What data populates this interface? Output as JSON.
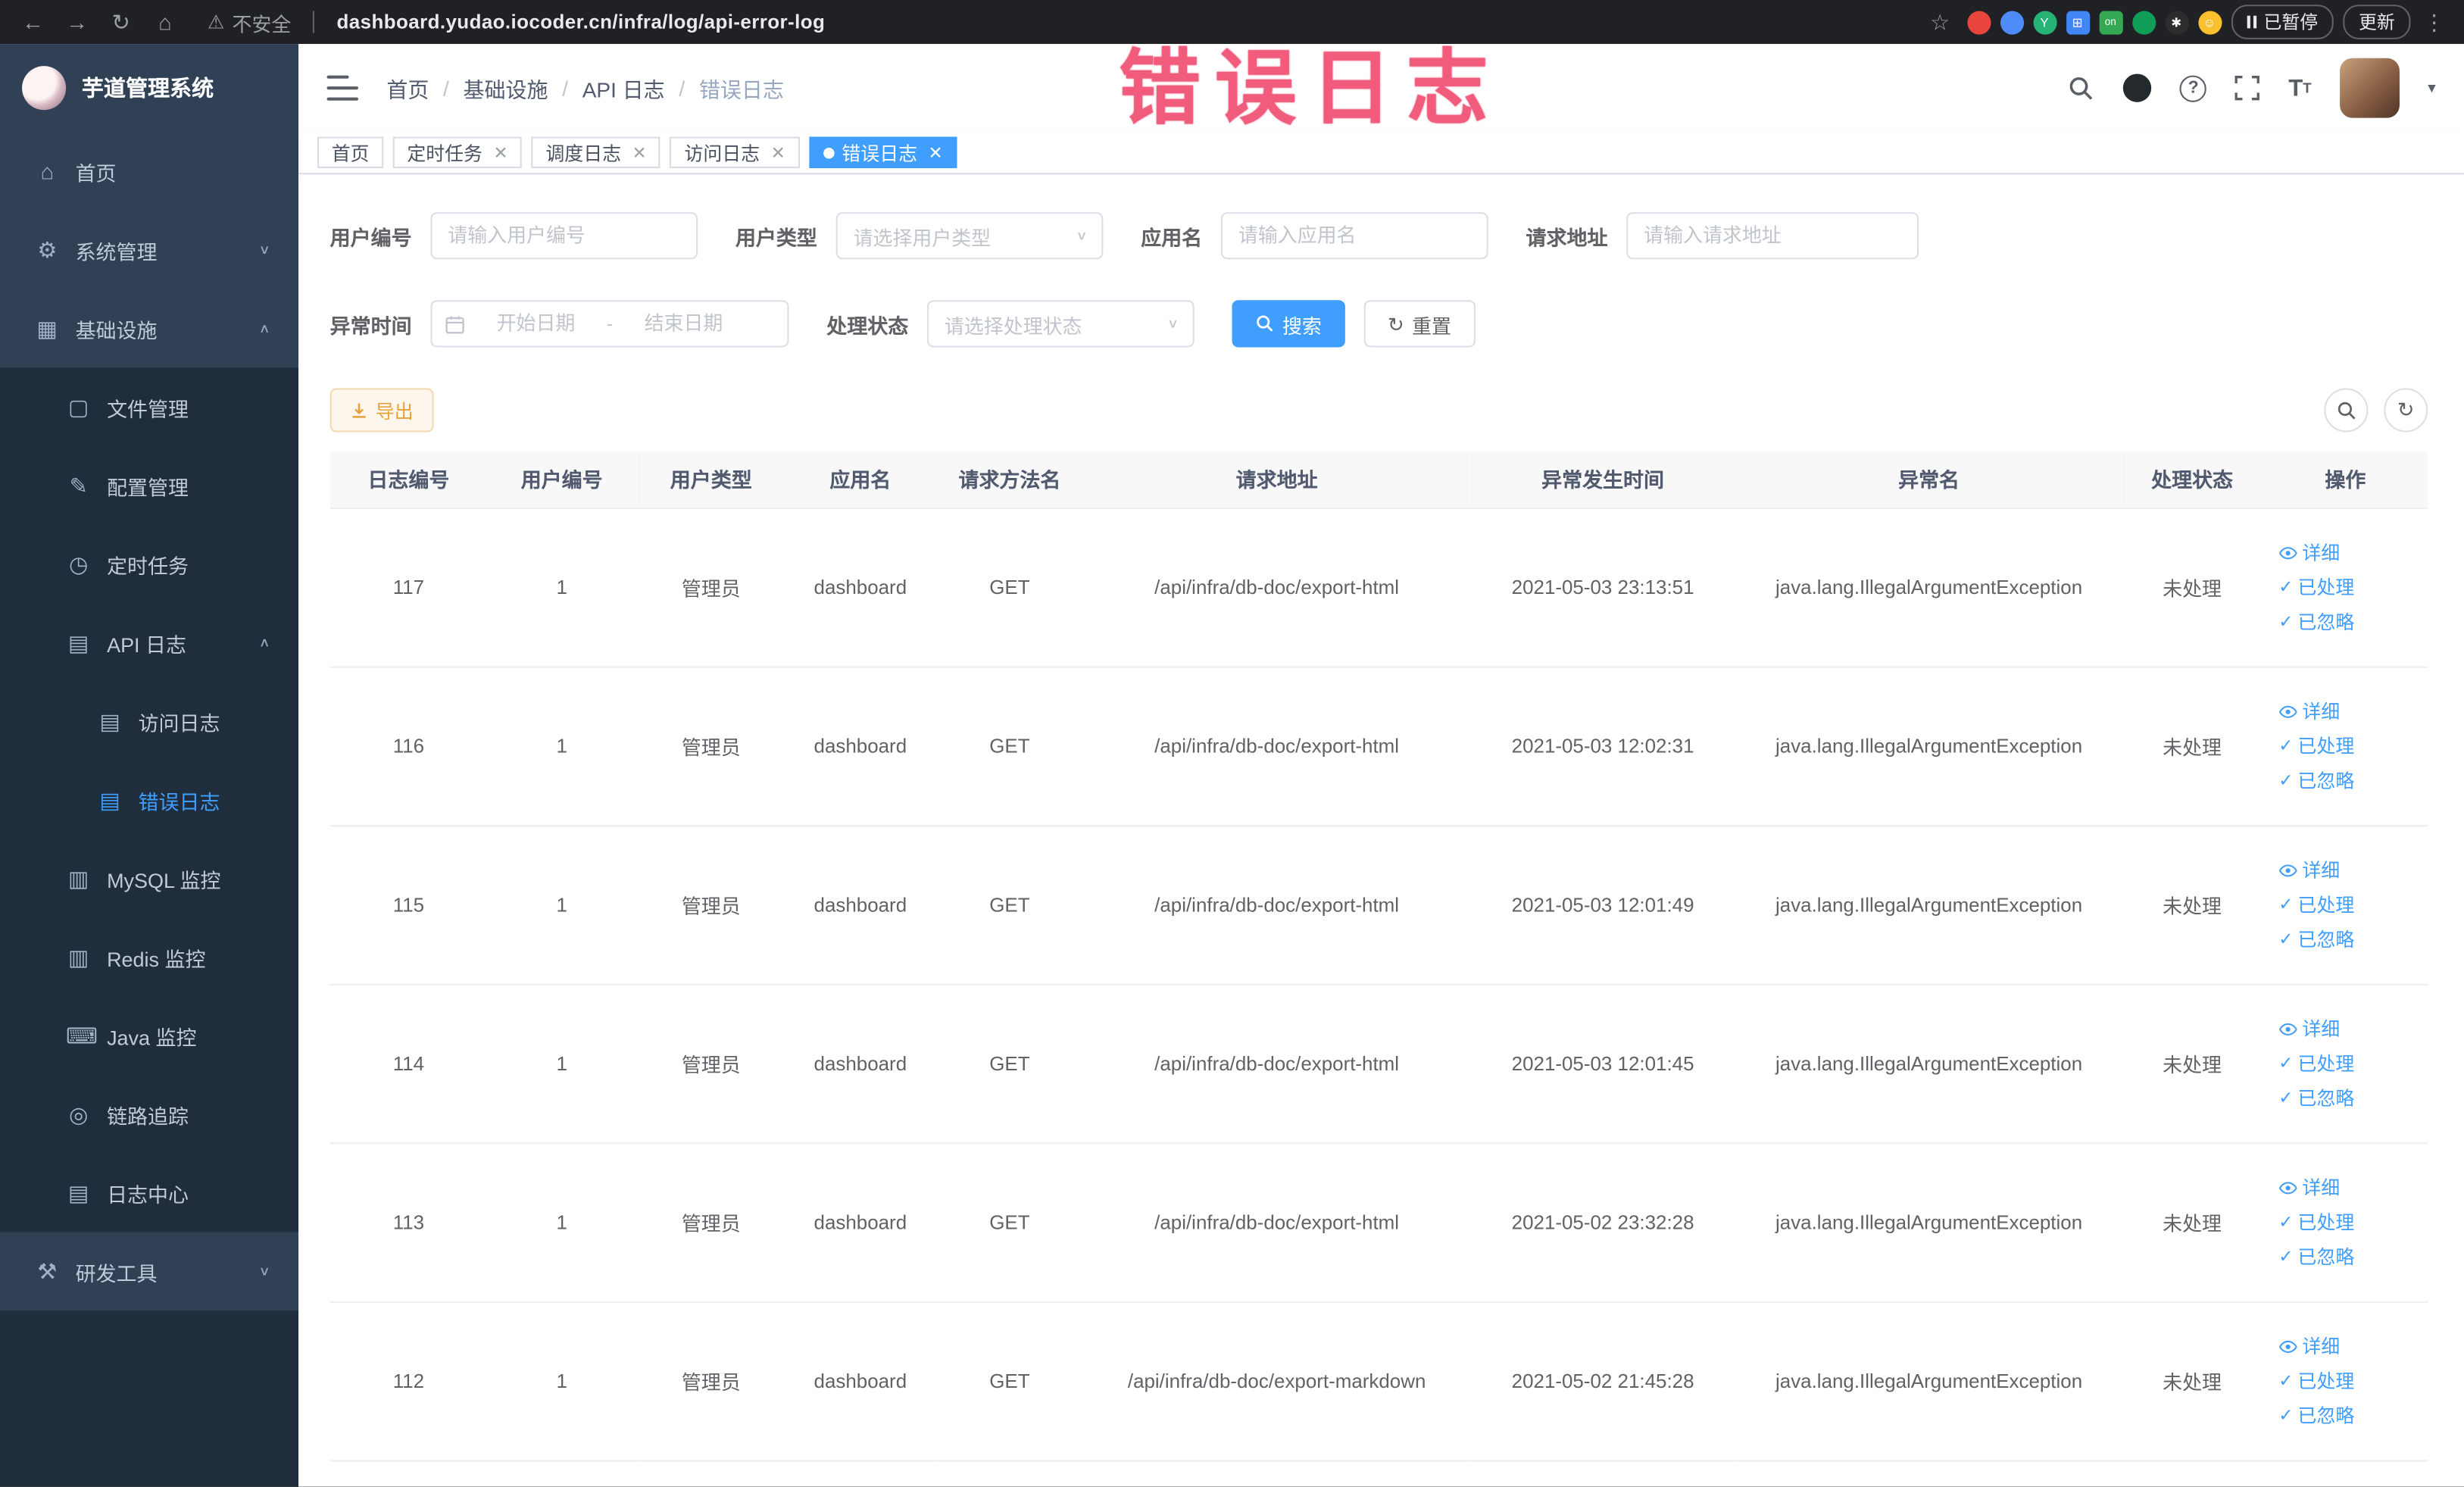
{
  "browser": {
    "security_label": "不安全",
    "url": "dashboard.yudao.iocoder.cn/infra/log/api-error-log",
    "paused_badge": "已暂停",
    "update_button": "更新"
  },
  "overlay": {
    "title": "错误日志"
  },
  "sidebar": {
    "logo_title": "芋道管理系统",
    "items": [
      {
        "label": "首页"
      },
      {
        "label": "系统管理"
      },
      {
        "label": "基础设施"
      },
      {
        "label": "文件管理"
      },
      {
        "label": "配置管理"
      },
      {
        "label": "定时任务"
      },
      {
        "label": "API 日志"
      },
      {
        "label": "访问日志"
      },
      {
        "label": "错误日志"
      },
      {
        "label": "MySQL 监控"
      },
      {
        "label": "Redis 监控"
      },
      {
        "label": "Java 监控"
      },
      {
        "label": "链路追踪"
      },
      {
        "label": "日志中心"
      },
      {
        "label": "研发工具"
      }
    ]
  },
  "header": {
    "breadcrumb": [
      "首页",
      "基础设施",
      "API 日志",
      "错误日志"
    ]
  },
  "tabs": [
    {
      "label": "首页"
    },
    {
      "label": "定时任务"
    },
    {
      "label": "调度日志"
    },
    {
      "label": "访问日志"
    },
    {
      "label": "错误日志"
    }
  ],
  "filters": {
    "user_id": {
      "label": "用户编号",
      "placeholder": "请输入用户编号"
    },
    "user_type": {
      "label": "用户类型",
      "placeholder": "请选择用户类型"
    },
    "app_name": {
      "label": "应用名",
      "placeholder": "请输入应用名"
    },
    "request_url": {
      "label": "请求地址",
      "placeholder": "请输入请求地址"
    },
    "exception_time": {
      "label": "异常时间",
      "start_placeholder": "开始日期",
      "separator": "-",
      "end_placeholder": "结束日期"
    },
    "process_status": {
      "label": "处理状态",
      "placeholder": "请选择处理状态"
    },
    "search_label": "搜索",
    "reset_label": "重置"
  },
  "toolbar": {
    "export_label": "导出"
  },
  "table": {
    "columns": [
      "日志编号",
      "用户编号",
      "用户类型",
      "应用名",
      "请求方法名",
      "请求地址",
      "异常发生时间",
      "异常名",
      "处理状态",
      "操作"
    ],
    "actions": {
      "detail": "详细",
      "processed": "已处理",
      "ignored": "已忽略"
    },
    "rows": [
      {
        "id": "117",
        "user_id": "1",
        "user_type": "管理员",
        "app": "dashboard",
        "method": "GET",
        "url": "/api/infra/db-doc/export-html",
        "time": "2021-05-03 23:13:51",
        "exception": "java.lang.IllegalArgumentException",
        "status": "未处理"
      },
      {
        "id": "116",
        "user_id": "1",
        "user_type": "管理员",
        "app": "dashboard",
        "method": "GET",
        "url": "/api/infra/db-doc/export-html",
        "time": "2021-05-03 12:02:31",
        "exception": "java.lang.IllegalArgumentException",
        "status": "未处理"
      },
      {
        "id": "115",
        "user_id": "1",
        "user_type": "管理员",
        "app": "dashboard",
        "method": "GET",
        "url": "/api/infra/db-doc/export-html",
        "time": "2021-05-03 12:01:49",
        "exception": "java.lang.IllegalArgumentException",
        "status": "未处理"
      },
      {
        "id": "114",
        "user_id": "1",
        "user_type": "管理员",
        "app": "dashboard",
        "method": "GET",
        "url": "/api/infra/db-doc/export-html",
        "time": "2021-05-03 12:01:45",
        "exception": "java.lang.IllegalArgumentException",
        "status": "未处理"
      },
      {
        "id": "113",
        "user_id": "1",
        "user_type": "管理员",
        "app": "dashboard",
        "method": "GET",
        "url": "/api/infra/db-doc/export-html",
        "time": "2021-05-02 23:32:28",
        "exception": "java.lang.IllegalArgumentException",
        "status": "未处理"
      },
      {
        "id": "112",
        "user_id": "1",
        "user_type": "管理员",
        "app": "dashboard",
        "method": "GET",
        "url": "/api/infra/db-doc/export-markdown",
        "time": "2021-05-02 21:45:28",
        "exception": "java.lang.IllegalArgumentException",
        "status": "未处理"
      }
    ]
  },
  "colors": {
    "accent": "#409EFF",
    "warning": "#E6A23C",
    "overlay_red": "#F0456B",
    "sidebar_bg": "#304156",
    "submenu_bg": "#1F2D3D"
  }
}
